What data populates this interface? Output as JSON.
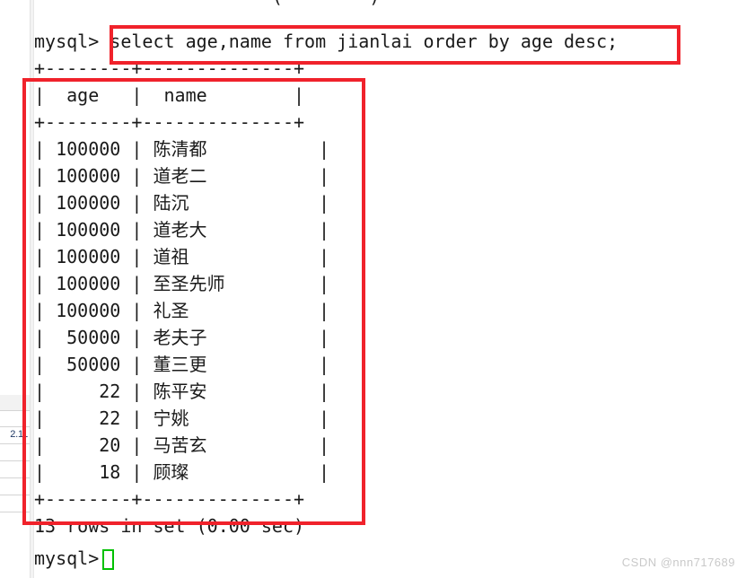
{
  "terminal": {
    "clipped_previous_line": "                      (        )",
    "prompt": "mysql>",
    "query": "select age,name from jianlai order by age desc;",
    "separator": "+--------+--------------+",
    "header_row": "|  age   |  name        |",
    "footer_status": "13 rows in set (0.00 sec)",
    "final_prompt": "mysql>",
    "cursor": "block-cursor"
  },
  "result_table": {
    "columns": [
      "age",
      "name"
    ],
    "rows": [
      {
        "age": "100000",
        "name": "陈清都"
      },
      {
        "age": "100000",
        "name": "道老二"
      },
      {
        "age": "100000",
        "name": "陆沉"
      },
      {
        "age": "100000",
        "name": "道老大"
      },
      {
        "age": "100000",
        "name": "道祖"
      },
      {
        "age": "100000",
        "name": "至圣先师"
      },
      {
        "age": "100000",
        "name": "礼圣"
      },
      {
        "age": "50000",
        "name": "老夫子"
      },
      {
        "age": "50000",
        "name": "董三更"
      },
      {
        "age": "22",
        "name": "陈平安"
      },
      {
        "age": "22",
        "name": "宁姚"
      },
      {
        "age": "20",
        "name": "马苦玄"
      },
      {
        "age": "18",
        "name": "顾璨"
      }
    ],
    "row_count_text": "13 rows in set (0.00 sec)"
  },
  "annotations": [
    {
      "name": "query-highlight",
      "color": "#f0222b"
    },
    {
      "name": "result-highlight",
      "color": "#f0222b"
    }
  ],
  "side_panel": {
    "visible_value": "2.11"
  },
  "watermark": {
    "text": "CSDN @nnn717689"
  },
  "colors": {
    "annotation_red": "#f0222b",
    "cursor_green": "#00c000",
    "text": "#1a1a1a",
    "watermark": "#c9c9c9",
    "side_value": "#1f3864"
  }
}
